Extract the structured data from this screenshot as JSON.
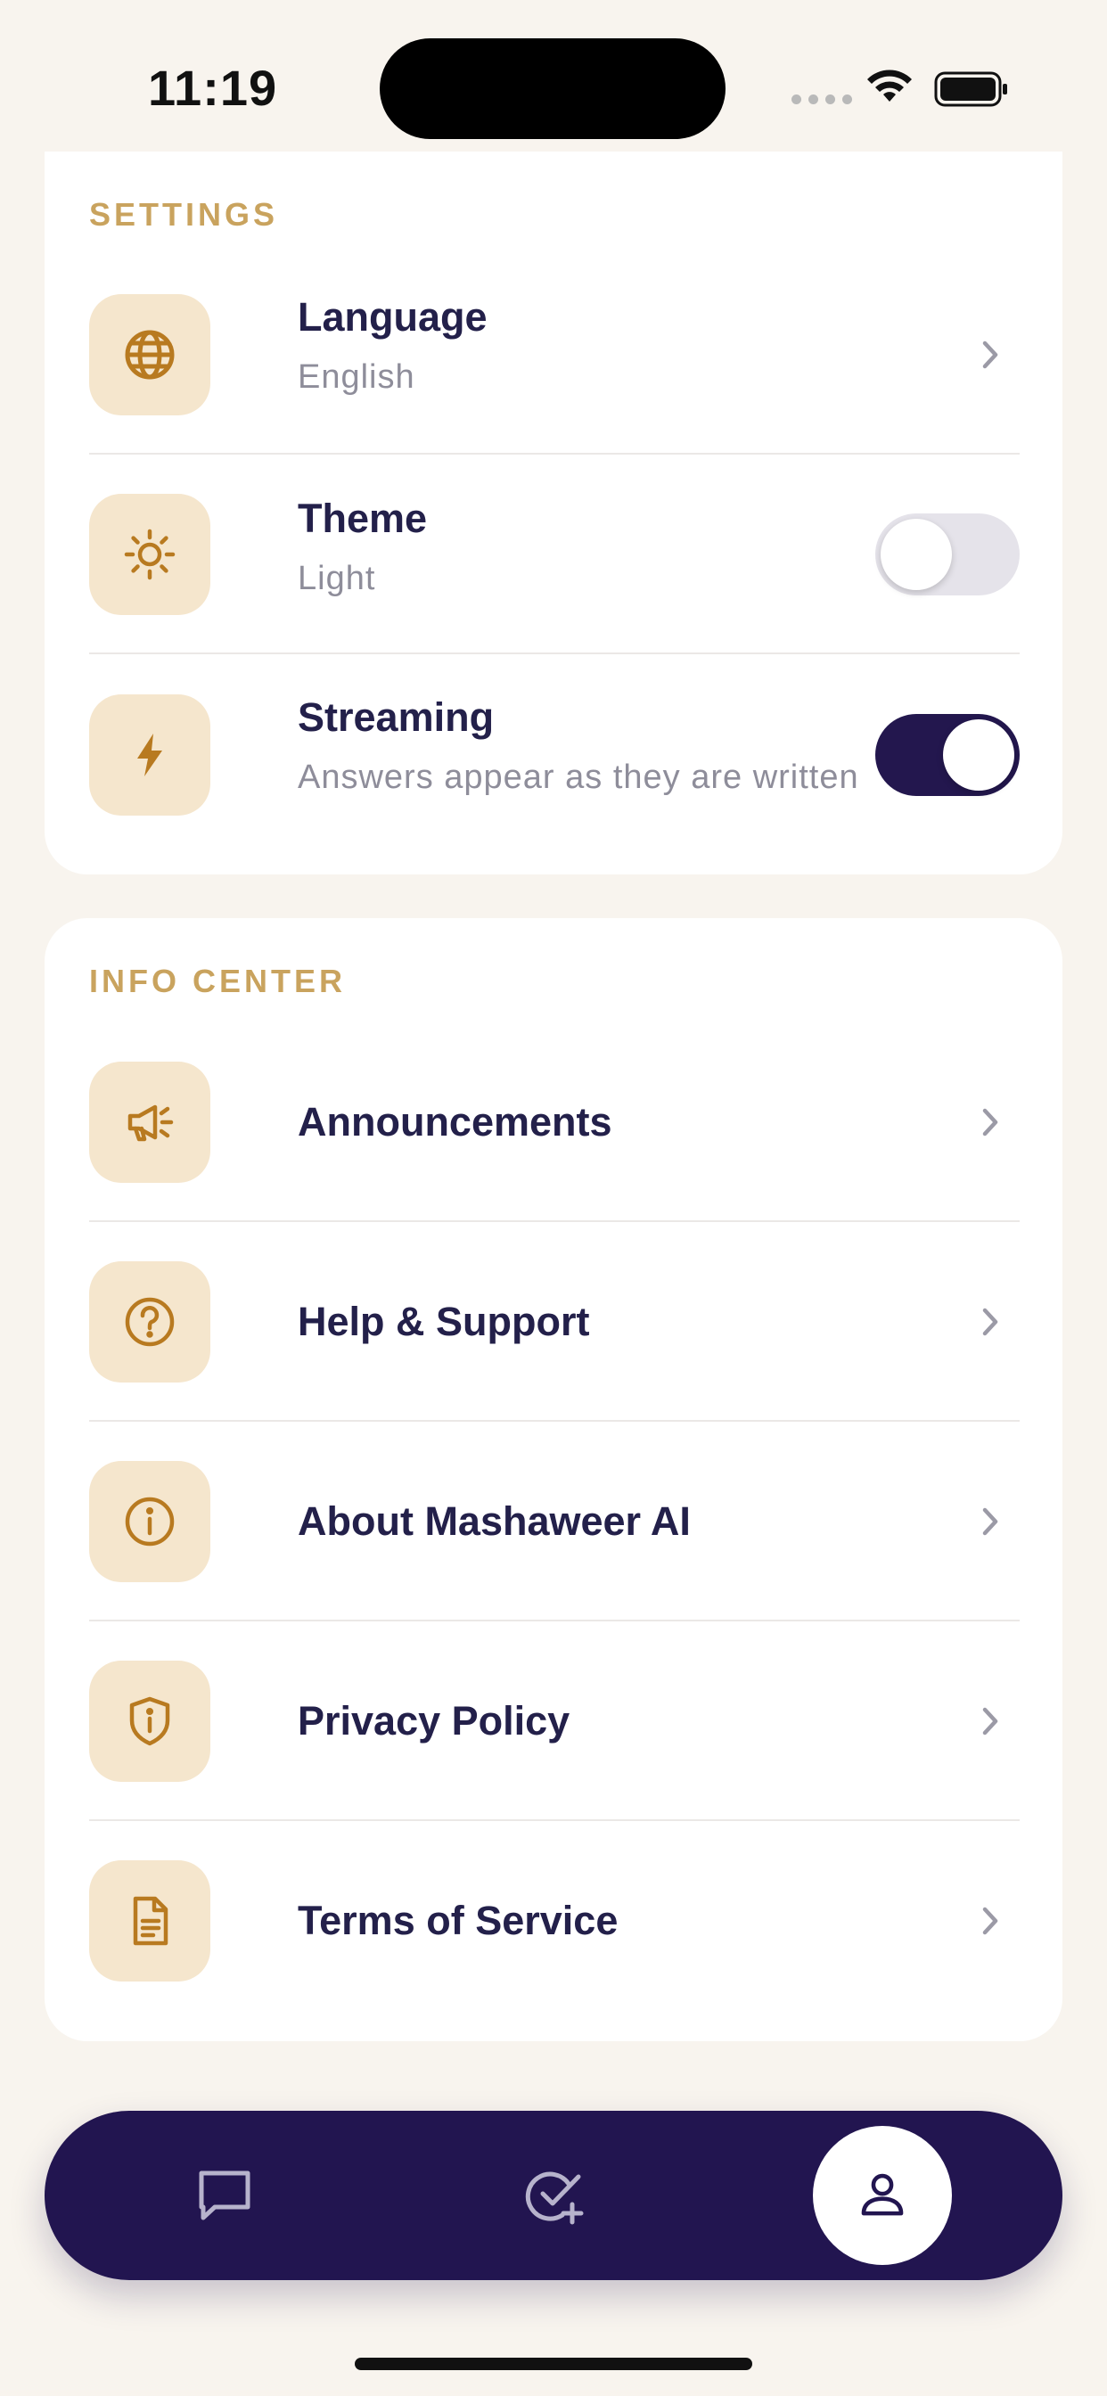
{
  "status_bar": {
    "time": "11:19"
  },
  "settings": {
    "title": "SETTINGS",
    "language": {
      "label": "Language",
      "value": "English",
      "icon": "globe-icon"
    },
    "theme": {
      "label": "Theme",
      "value": "Light",
      "icon": "sun-icon",
      "enabled": false
    },
    "streaming": {
      "label": "Streaming",
      "description": "Answers appear as they are written",
      "icon": "bolt-icon",
      "enabled": true
    }
  },
  "info_center": {
    "title": "INFO CENTER",
    "items": [
      {
        "label": "Announcements",
        "icon": "megaphone-icon"
      },
      {
        "label": "Help & Support",
        "icon": "question-circle-icon"
      },
      {
        "label": "About Mashaweer AI",
        "icon": "info-circle-icon"
      },
      {
        "label": "Privacy Policy",
        "icon": "shield-icon"
      },
      {
        "label": "Terms of Service",
        "icon": "document-icon"
      }
    ]
  },
  "tab_bar": {
    "tabs": [
      {
        "name": "chat",
        "icon": "chat-bubble-icon",
        "active": false
      },
      {
        "name": "tasks",
        "icon": "check-add-icon",
        "active": false
      },
      {
        "name": "profile",
        "icon": "user-icon",
        "active": true
      }
    ]
  },
  "colors": {
    "background": "#f8f4ee",
    "accent_gold": "#c9a35e",
    "icon_gold": "#b87a20",
    "icon_box": "#f5e6cd",
    "primary_navy": "#221550",
    "text_dark": "#23204a",
    "text_muted": "#8e8d9a"
  }
}
